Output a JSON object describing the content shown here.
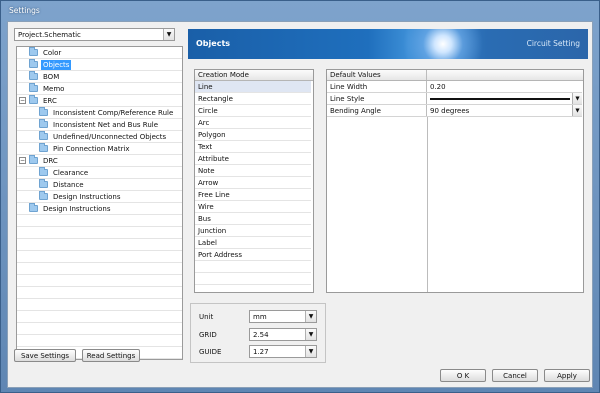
{
  "window": {
    "title": "Settings"
  },
  "project_select": {
    "value": "Project.Schematic"
  },
  "tree": [
    {
      "label": "Color",
      "level": 1,
      "selected": false
    },
    {
      "label": "Objects",
      "level": 1,
      "selected": true
    },
    {
      "label": "BOM",
      "level": 1,
      "selected": false
    },
    {
      "label": "Memo",
      "level": 1,
      "selected": false
    },
    {
      "label": "ERC",
      "level": 0,
      "expander": "−",
      "selected": false
    },
    {
      "label": "Inconsistent Comp/Reference Rule",
      "level": 2,
      "selected": false
    },
    {
      "label": "Inconsistent Net and Bus Rule",
      "level": 2,
      "selected": false
    },
    {
      "label": "Undefined/Unconnected Objects",
      "level": 2,
      "selected": false
    },
    {
      "label": "Pin Connection Matrix",
      "level": 2,
      "selected": false
    },
    {
      "label": "DRC",
      "level": 0,
      "expander": "−",
      "selected": false
    },
    {
      "label": "Clearance",
      "level": 2,
      "selected": false
    },
    {
      "label": "Distance",
      "level": 2,
      "selected": false
    },
    {
      "label": "Design Instructions",
      "level": 2,
      "selected": false
    },
    {
      "label": "Design Instructions",
      "level": 1,
      "selected": false
    }
  ],
  "buttons": {
    "save_settings": "Save Settings",
    "read_settings": "Read Settings",
    "ok": "O K",
    "cancel": "Cancel",
    "apply": "Apply"
  },
  "banner": {
    "title": "Objects",
    "subtitle": "Circuit Setting"
  },
  "creation_mode": {
    "header": "Creation Mode",
    "items": [
      "Line",
      "Rectangle",
      "Circle",
      "Arc",
      "Polygon",
      "Text",
      "Attribute",
      "Note",
      "Arrow",
      "Free Line",
      "Wire",
      "Bus",
      "Junction",
      "Label",
      "Port Address"
    ],
    "selected": "Line"
  },
  "default_values": {
    "header": "Default Values",
    "rows": [
      {
        "key": "Line Width",
        "value": "0.20",
        "kind": "text"
      },
      {
        "key": "Line Style",
        "value": "",
        "kind": "line"
      },
      {
        "key": "Bending Angle",
        "value": "90 degrees",
        "kind": "dropdown"
      }
    ]
  },
  "grid_settings": {
    "unit_label": "Unit",
    "unit_value": "mm",
    "grid_label": "GRID",
    "grid_value": "2.54",
    "guide_label": "GUIDE",
    "guide_value": "1.27"
  },
  "colors": {
    "title_bar": "#6e95c2",
    "selection": "#3399ff",
    "banner": "#1f6fbd"
  }
}
